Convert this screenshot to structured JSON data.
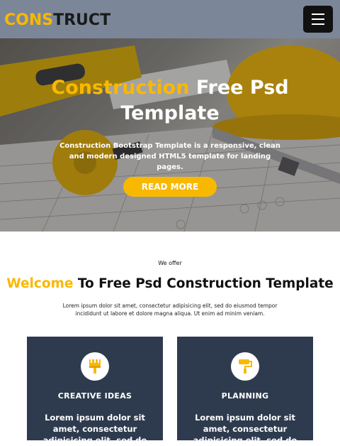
{
  "header": {
    "logo_part1": "CONS",
    "logo_part2": "TRUCT",
    "menu_icon": "hamburger-menu-icon"
  },
  "hero": {
    "title_highlight": "Construction",
    "title_rest_line1": " Free Psd",
    "title_line2": "Template",
    "subtitle": "Construction Bootstrap Template is a responsive, clean and modern designed HTML5 template for landing pages.",
    "button_label": "READ MORE"
  },
  "offer": {
    "kicker": "We offer",
    "heading_highlight": "Welcome",
    "heading_rest": " To Free Psd Construction Template",
    "description": "Lorem ipsum dolor sit amet, consectetur adipisicing elit, sed do eiusmod tempor incididunt ut labore et dolore magna aliqua. Ut enim ad minim veniam."
  },
  "cards": [
    {
      "icon": "paint-brush-icon",
      "title": "CREATIVE IDEAS",
      "text": "Lorem ipsum dolor sit amet, consectetur adipisicing elit, sed do"
    },
    {
      "icon": "paint-roller-icon",
      "title": "PLANNING",
      "text": "Lorem ipsum dolor sit amet, consectetur adipisicing elit, sed do"
    }
  ],
  "colors": {
    "accent": "#f9b800",
    "header_bg": "#7b8799",
    "card_bg": "#2e3b4e"
  }
}
